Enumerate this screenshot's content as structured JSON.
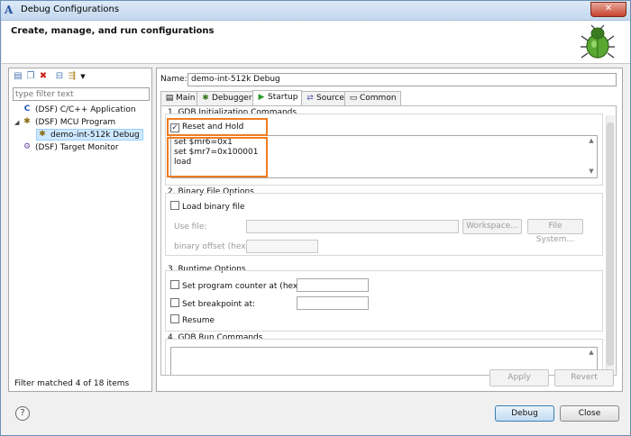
{
  "window": {
    "title": "Debug Configurations",
    "close_glyph": "✕"
  },
  "header": {
    "title": "Create, manage, and run configurations"
  },
  "sidebar": {
    "filter_placeholder": "type filter text",
    "items": [
      {
        "label": "(DSF) C/C++ Application",
        "icon": "c-app-icon"
      },
      {
        "label": "(DSF) MCU Program",
        "icon": "mcu-program-icon"
      },
      {
        "label": "demo-int-512k Debug",
        "icon": "debug-config-icon"
      },
      {
        "label": "(DSF) Target Monitor",
        "icon": "target-monitor-icon"
      }
    ],
    "filter_status": "Filter matched 4 of 18 items"
  },
  "config": {
    "name_label": "Name:",
    "name_value": "demo-int-512k Debug",
    "tabs": [
      {
        "label": "Main",
        "icon": "main-tab-icon"
      },
      {
        "label": "Debugger",
        "icon": "debugger-tab-icon"
      },
      {
        "label": "Startup",
        "icon": "startup-tab-icon",
        "active": true
      },
      {
        "label": "Source",
        "icon": "source-tab-icon"
      },
      {
        "label": "Common",
        "icon": "common-tab-icon"
      }
    ]
  },
  "startup": {
    "gdb_init": {
      "title": "1. GDB Initialization Commands",
      "reset_and_hold_label": "Reset and Hold",
      "reset_and_hold_checked": true,
      "commands": [
        "set $mr6=0x1",
        "set $mr7=0x100001",
        "load"
      ]
    },
    "binary": {
      "title": "2. Binary File Options",
      "load_binary_label": "Load binary file",
      "use_file_label": "Use file:",
      "workspace_button": "Workspace...",
      "filesystem_button": "File System...",
      "binary_offset_label": "binary offset (hex):"
    },
    "runtime": {
      "title": "3. Runtime Options",
      "set_pc_label": "Set program counter at (hex):",
      "set_breakpoint_label": "Set breakpoint at:",
      "resume_label": "Resume"
    },
    "run_commands": {
      "title": "4. GDB Run Commands"
    }
  },
  "actions": {
    "apply": "Apply",
    "revert": "Revert",
    "debug": "Debug",
    "close": "Close",
    "help_glyph": "?"
  },
  "colors": {
    "highlight": "#f07c20",
    "selection": "#cde8ff"
  }
}
